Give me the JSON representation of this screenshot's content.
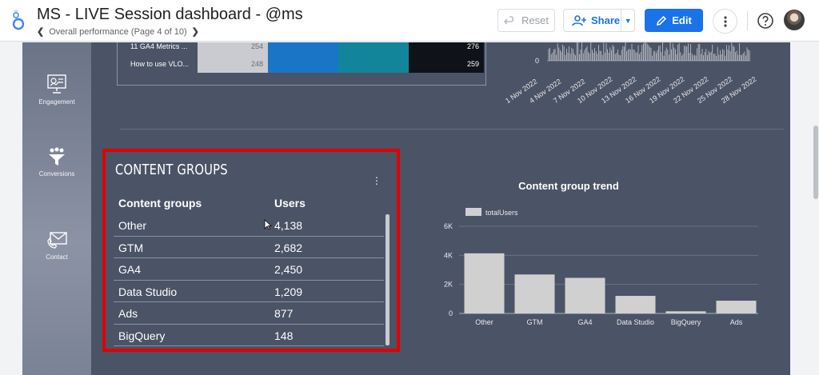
{
  "header": {
    "title": "MS - LIVE Session dashboard - @ms",
    "breadcrumb": "Overall performance (Page 4 of 10)",
    "reset_label": "Reset",
    "share_label": "Share",
    "edit_label": "Edit"
  },
  "sidenav": {
    "items": [
      {
        "label": "Engagement",
        "icon": "engagement-icon"
      },
      {
        "label": "Conversions",
        "icon": "conversions-icon"
      },
      {
        "label": "Contact",
        "icon": "contact-icon"
      }
    ]
  },
  "top_table": {
    "rows": [
      {
        "name": "11 GA4 Metrics ...",
        "v1": "254",
        "v4": "276"
      },
      {
        "name": "How to use VLO...",
        "v1": "248",
        "v4": "259"
      }
    ]
  },
  "top_trend": {
    "zero_label": "0",
    "dates": [
      "1 Nov 2022",
      "4 Nov 2022",
      "7 Nov 2022",
      "10 Nov 2022",
      "13 Nov 2022",
      "16 Nov 2022",
      "19 Nov 2022",
      "22 Nov 2022",
      "25 Nov 2022",
      "28 Nov 2022"
    ]
  },
  "content_groups": {
    "title": "CONTENT GROUPS",
    "col_group": "Content groups",
    "col_users": "Users",
    "rows": [
      {
        "name": "Other",
        "users": "4,138"
      },
      {
        "name": "GTM",
        "users": "2,682"
      },
      {
        "name": "GA4",
        "users": "2,450"
      },
      {
        "name": "Data Studio",
        "users": "1,209"
      },
      {
        "name": "Ads",
        "users": "877"
      },
      {
        "name": "BigQuery",
        "users": "148"
      }
    ]
  },
  "colors": {
    "accent": "#1a73e8",
    "highlight_box": "#e00000",
    "report_bg": "#4b5366",
    "bar": "#d0d0d0"
  },
  "chart_data": {
    "type": "bar",
    "title": "Content group trend",
    "legend": [
      "totalUsers"
    ],
    "legend_position": "top-left",
    "categories": [
      "Other",
      "GTM",
      "GA4",
      "Data Studio",
      "BigQuery",
      "Ads"
    ],
    "series": [
      {
        "name": "totalUsers",
        "values": [
          4138,
          2682,
          2450,
          1209,
          148,
          877
        ]
      }
    ],
    "y_ticks": [
      "0",
      "2K",
      "4K",
      "6K"
    ],
    "ylim": [
      0,
      6000
    ],
    "grid": true
  }
}
